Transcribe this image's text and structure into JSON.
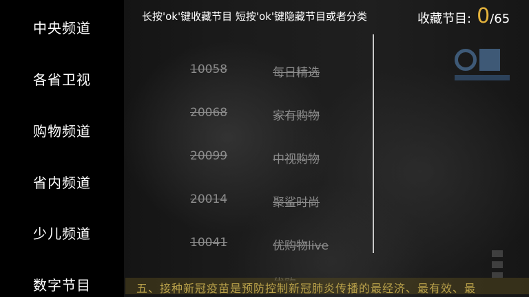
{
  "sidebar": {
    "items": [
      {
        "label": "中央频道"
      },
      {
        "label": "各省卫视"
      },
      {
        "label": "购物频道"
      },
      {
        "label": "省内频道"
      },
      {
        "label": "少儿频道"
      },
      {
        "label": "数字节目"
      }
    ]
  },
  "header": {
    "hint": "长按'ok'键收藏节目 短按'ok'键隐藏节目或者分类",
    "favorites_label": "收藏节目:",
    "favorites_count": "0",
    "favorites_total": "/65"
  },
  "channels": [
    {
      "number": "10058",
      "name": "每日精选"
    },
    {
      "number": "20068",
      "name": "家有购物"
    },
    {
      "number": "20099",
      "name": "中视购物"
    },
    {
      "number": "20014",
      "name": "聚鲨时尚"
    },
    {
      "number": "10041",
      "name": "优购物live"
    }
  ],
  "partial_channel": {
    "name": "优购"
  },
  "ticker": {
    "text": "五、接种新冠疫苗是预防控制新冠肺炎传播的最经济、最有效、最"
  },
  "colors": {
    "accent": "#e3b23c",
    "disabled_text": "#8c8c8c",
    "sidebar_bg": "#000000"
  },
  "icons": {
    "channel_logo": "station-logo"
  }
}
